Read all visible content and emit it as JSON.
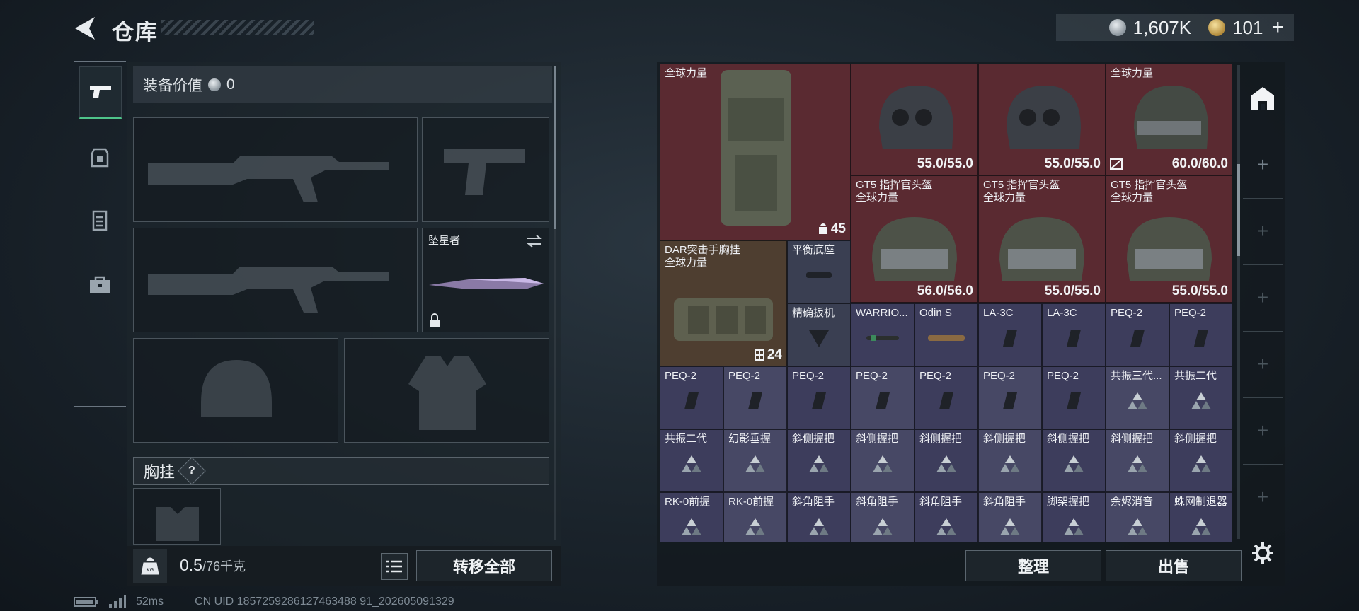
{
  "header": {
    "title": "仓库",
    "currency_silver": "1,607K",
    "currency_gold": "101",
    "plus": "+"
  },
  "rail": {
    "items": [
      "weapons",
      "backpack",
      "armor",
      "case"
    ]
  },
  "equip": {
    "value_label": "装备价值",
    "value": "0",
    "melee_name": "坠星者",
    "chest_label": "胸挂",
    "help": "?"
  },
  "bottom": {
    "weight": "0.5",
    "weight_unit": "/76千克",
    "transfer_label": "转移全部"
  },
  "status": {
    "ping": "52ms",
    "uid": "CN UID 1857259286127463488 91_202605091329"
  },
  "storage": {
    "cells": [
      {
        "name": "全球力量",
        "name2": "",
        "extra": "",
        "kind": "red"
      },
      {
        "name": "",
        "name2": "",
        "extra": "55.0/55.0",
        "kind": "red"
      },
      {
        "name": "",
        "name2": "",
        "extra": "55.0/55.0",
        "kind": "red"
      },
      {
        "name": "全球力量",
        "name2": "",
        "extra": "60.0/60.0",
        "kind": "red"
      },
      {
        "name": "",
        "name2": "",
        "extra": "45",
        "kind": "red"
      },
      {
        "name": "GT5 指挥官头盔",
        "name2": "全球力量",
        "extra": "56.0/56.0",
        "kind": "red"
      },
      {
        "name": "GT5 指挥官头盔",
        "name2": "全球力量",
        "extra": "55.0/55.0",
        "kind": "red"
      },
      {
        "name": "GT5 指挥官头盔",
        "name2": "全球力量",
        "extra": "55.0/55.0",
        "kind": "red"
      },
      {
        "name": "DAR突击手胸挂",
        "name2": "全球力量",
        "extra": "24",
        "kind": "brown"
      },
      {
        "name": "平衡底座",
        "name2": "",
        "extra": "",
        "kind": "slate"
      },
      {
        "name": "精确扳机",
        "name2": "",
        "extra": "",
        "kind": "slate"
      },
      {
        "name": "WARRIO...",
        "name2": "",
        "extra": "",
        "kind": "purple"
      },
      {
        "name": "Odin S",
        "name2": "",
        "extra": "",
        "kind": "purple"
      },
      {
        "name": "LA-3C",
        "name2": "",
        "extra": "",
        "kind": "purple"
      },
      {
        "name": "LA-3C",
        "name2": "",
        "extra": "",
        "kind": "purple"
      },
      {
        "name": "PEQ-2",
        "name2": "",
        "extra": "",
        "kind": "purple"
      },
      {
        "name": "PEQ-2",
        "name2": "",
        "extra": "",
        "kind": "purple"
      }
    ],
    "row3": [
      "PEQ-2",
      "PEQ-2",
      "PEQ-2",
      "PEQ-2",
      "PEQ-2",
      "PEQ-2",
      "PEQ-2",
      "共振三代...",
      "共振二代"
    ],
    "row4": [
      "共振二代",
      "幻影垂握",
      "斜侧握把",
      "斜侧握把",
      "斜侧握把",
      "斜侧握把",
      "斜侧握把",
      "斜侧握把",
      "斜侧握把"
    ],
    "row5": [
      "RK-0前握",
      "RK-0前握",
      "斜角阻手",
      "斜角阻手",
      "斜角阻手",
      "斜角阻手",
      "脚架握把",
      "余烬消音",
      "蛛网制退器"
    ],
    "sort_label": "整理",
    "sell_label": "出售"
  }
}
